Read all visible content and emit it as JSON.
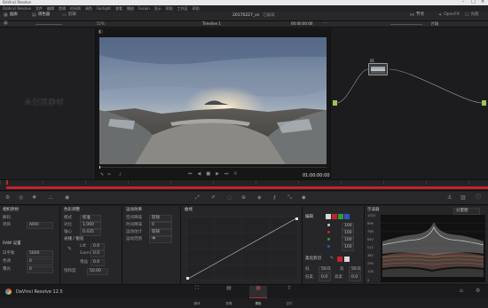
{
  "window": {
    "title": "DaVinci Resolve",
    "menu": [
      "DaVinci Resolve",
      "文件",
      "编辑",
      "剪辑",
      "时间线",
      "调色",
      "Fairlight",
      "查看",
      "播放",
      "Fusion",
      "显示",
      "帮助",
      "工作区",
      "帮助"
    ]
  },
  "topbar": {
    "left_tabs": [
      "画廊",
      "调色器",
      "剪辑"
    ],
    "project_title": "20170227_vs",
    "project_status": "已编辑",
    "right_tabs": [
      "节点",
      "OpenFX",
      "光照"
    ]
  },
  "viewer_bar": {
    "zoom": "52%",
    "timeline_name": "Timeline 1",
    "timecode_left": "00:00:00:00",
    "clip_label": "片段"
  },
  "gallery": {
    "empty_text": "未创建静帧"
  },
  "transport": {
    "timecode": "01:00:00:00"
  },
  "node": {
    "label": "01"
  },
  "panels": {
    "camera_raw": {
      "title": "相机原始",
      "decode_label": "解码",
      "rows": [
        {
          "label": "项目",
          "value": "ARRI"
        },
        {
          "label": "白平衡",
          "value": "5600"
        },
        {
          "label": "色调",
          "value": "0"
        },
        {
          "label": "曝光",
          "value": "0"
        }
      ],
      "section": "RAW 设置"
    },
    "color_wheels": {
      "title": "色彩调整",
      "rows": [
        {
          "label": "模式",
          "value": "校准"
        },
        {
          "label": "对比",
          "value": "1.000"
        },
        {
          "label": "轴心",
          "value": "0.435"
        },
        {
          "label": "饱和度",
          "value": "50.00"
        }
      ],
      "section": "光线 / 锐化",
      "lift": {
        "label": "Lift",
        "value": "0.0"
      },
      "gamma": {
        "label": "Gamma",
        "value": "0.0"
      },
      "gain": {
        "label": "增益",
        "value": "0.0"
      }
    },
    "motion": {
      "title": "运动效果",
      "rows": [
        {
          "label": "空间降噪",
          "value": "较快"
        },
        {
          "label": "时间降噪",
          "value": "0"
        },
        {
          "label": "运动估计",
          "value": "较快"
        },
        {
          "label": "运动范围",
          "value": "中"
        }
      ]
    },
    "curves": {
      "title": "曲线"
    },
    "curve_editor": {
      "edit_label": "编辑",
      "values": [
        "100",
        "100",
        "100",
        "100"
      ],
      "soft_clip_label": "柔化剪切",
      "low_label": "低",
      "low_value": "50.0",
      "high_label": "高",
      "high_value": "50.0",
      "low_soft_label": "低柔",
      "low_soft_value": "0.0",
      "high_soft_label": "高柔",
      "high_soft_value": "0.0"
    },
    "scopes": {
      "title": "示波器",
      "mode": "分量图",
      "scale": [
        "1023",
        "896",
        "768",
        "640",
        "512",
        "384",
        "256",
        "128",
        "0"
      ]
    }
  },
  "footer": {
    "app_name": "DaVinci Resolve 12.5",
    "pages": [
      "媒体",
      "剪辑",
      "调色",
      "交付"
    ]
  },
  "colors": {
    "accent_red": "#c0242e",
    "node_green": "#9ec35a",
    "panel_bg": "#28282a",
    "viewer_sky": "#8a9bb0"
  }
}
